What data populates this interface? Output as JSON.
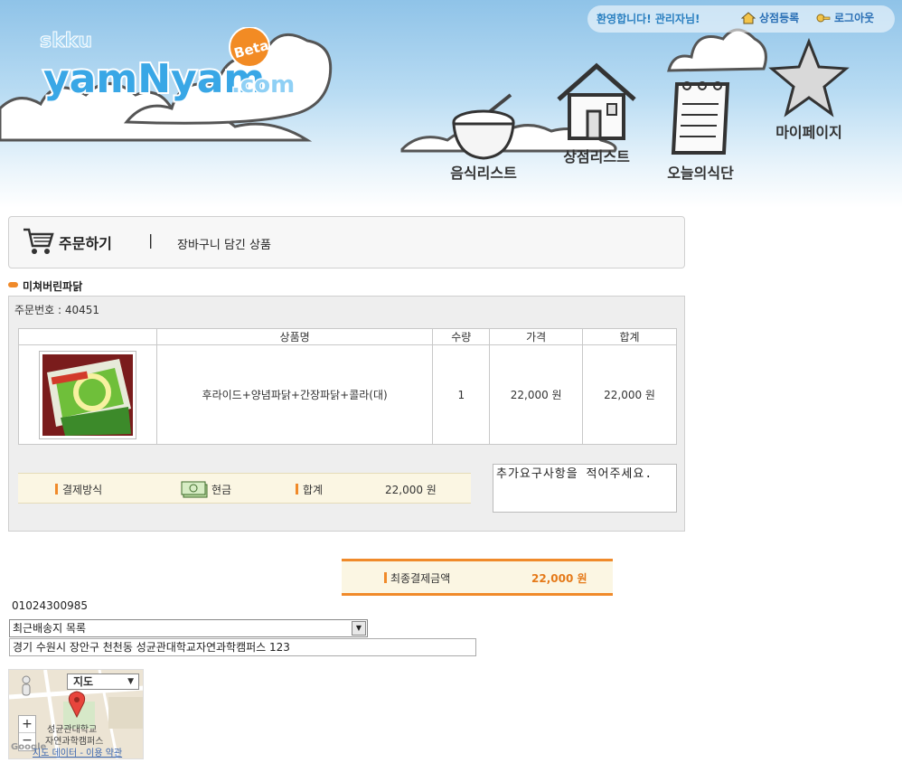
{
  "header": {
    "welcome": "환영합니다! 관리자님!",
    "store_register": "상점등록",
    "logout": "로그아웃",
    "logo_text": "yamNyam",
    "logo_domain": ".com",
    "logo_badge": "Beta",
    "logo_top": "skku",
    "nav": [
      {
        "label": "음식리스트",
        "icon": "rice-bowl-icon"
      },
      {
        "label": "상점리스트",
        "icon": "house-icon"
      },
      {
        "label": "오늘의식단",
        "icon": "notepad-icon"
      },
      {
        "label": "마이페이지",
        "icon": "star-icon"
      }
    ]
  },
  "order_section": {
    "title": "주문하기",
    "separator": "|",
    "subtitle": "장바구니 담긴 상품"
  },
  "store": {
    "name": "미쳐버린파닭",
    "order_number_label": "주문번호 : 40451"
  },
  "table": {
    "headers": [
      "",
      "상품명",
      "수량",
      "가격",
      "합계"
    ],
    "rows": [
      {
        "name": "후라이드+양념파닭+간장파닭+콜라(대)",
        "qty": "1",
        "price": "22,000 원",
        "total": "22,000 원"
      }
    ]
  },
  "payment": {
    "method_label": "결제방식",
    "method_value": "현금",
    "total_label": "합계",
    "total_value": "22,000 원"
  },
  "request_placeholder": "추가요구사항을 적어주세요.",
  "final": {
    "label": "최종결제금액",
    "amount": "22,000 원"
  },
  "phone": "01024300985",
  "address_select": "최근배송지 목록",
  "address_value": "경기 수원시 장안구 천천동 성균관대학교자연과학캠퍼스  123",
  "map": {
    "type_label": "지도",
    "place_label_1": "성균관대학교",
    "place_label_2": "자연과학캠퍼스",
    "footer": "지도 데이터 - 이용 약관",
    "google": "Google"
  },
  "colors": {
    "accent": "#f08a2a",
    "sky": "#8fc3e8",
    "link": "#2a6fb5"
  }
}
